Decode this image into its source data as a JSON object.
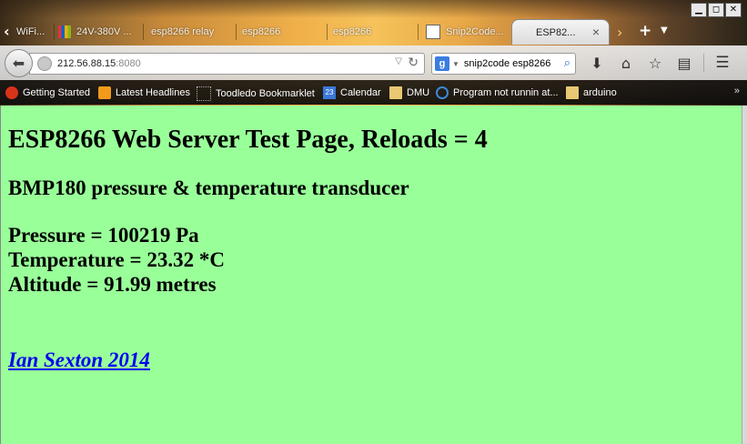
{
  "window": {
    "controls": {
      "minimize": "▁",
      "restore": "◻",
      "close": "✕"
    }
  },
  "tabs": [
    {
      "label": "WiFi..."
    },
    {
      "label": "24V-380V ..."
    },
    {
      "label": "esp8266 relay"
    },
    {
      "label": "esp8266"
    },
    {
      "label": "esp8266"
    },
    {
      "label": "Snip2Code..."
    },
    {
      "label": "ESP82...",
      "active": true,
      "close": "×"
    }
  ],
  "navbar": {
    "url_host": "212.56.88.15",
    "url_port": ":8080",
    "search_engine_icon": "google-icon",
    "search_value": "snip2code esp8266"
  },
  "bookmarks": [
    {
      "label": "Getting Started",
      "icon": "firefox-icon"
    },
    {
      "label": "Latest Headlines",
      "icon": "rss-icon"
    },
    {
      "label": "Toodledo Bookmarklet",
      "icon": "bookmarklet-icon"
    },
    {
      "label": "Calendar",
      "icon": "calendar-icon"
    },
    {
      "label": "DMU",
      "icon": "folder-icon"
    },
    {
      "label": "Program not runnin at...",
      "icon": "page-icon"
    },
    {
      "label": "arduino",
      "icon": "folder-icon"
    }
  ],
  "bookmarks_more": "»",
  "page": {
    "title": "ESP8266 Web Server Test Page, Reloads = 4",
    "subtitle": "BMP180 pressure & temperature transducer",
    "pressure": "Pressure = 100219 Pa",
    "temperature": "Temperature = 23.32 *C",
    "altitude": "Altitude = 91.99 metres",
    "credit": "Ian Sexton 2014",
    "background_color": "#99ff99",
    "link_color": "#0000ee"
  }
}
